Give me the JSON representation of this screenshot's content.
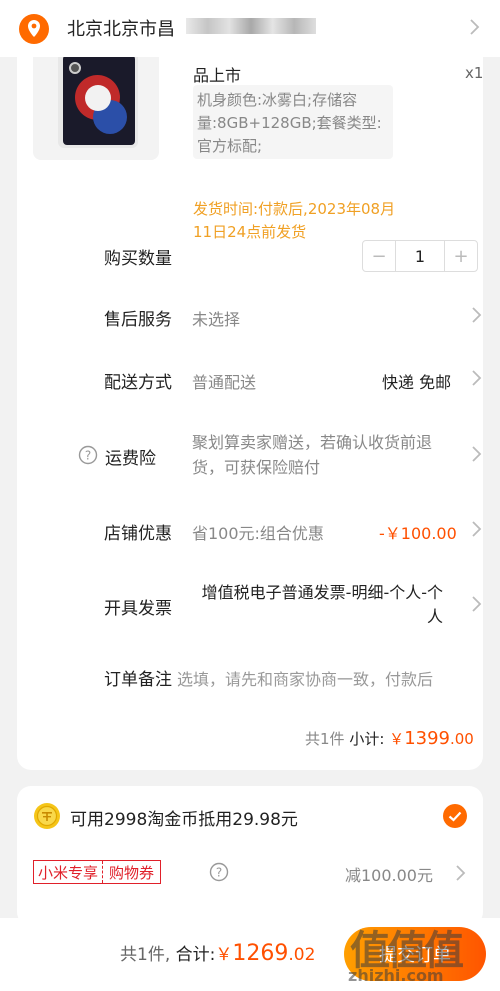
{
  "header": {
    "address": "北京北京市昌"
  },
  "product": {
    "name": "品上市",
    "quantity_mark": "x1",
    "specs": "机身颜色:冰雾白;存储容量:8GB+128GB;套餐类型:官方标配;",
    "ship_time": "发货时间:付款后,2023年08月11日24点前发货"
  },
  "rows": {
    "quantity": {
      "label": "购买数量",
      "value": "1",
      "minus": "−",
      "plus": "+"
    },
    "after_sales": {
      "label": "售后服务",
      "value": "未选择"
    },
    "delivery": {
      "label": "配送方式",
      "value": "普通配送",
      "option": "快递 免邮"
    },
    "insurance": {
      "label": "运费险",
      "value": "聚划算卖家赠送，若确认收货前退货，可获保险赔付"
    },
    "shop_discount": {
      "label": "店铺优惠",
      "value": "省100元:组合优惠",
      "amount": "-￥100.00"
    },
    "invoice": {
      "label": "开具发票",
      "value": "增值税电子普通发票-明细-个人-个人"
    },
    "note": {
      "label": "订单备注",
      "placeholder": "选填，请先和商家协商一致，付款后"
    }
  },
  "subtotal": {
    "count": "共1件",
    "label": "小计:",
    "currency": "￥",
    "integer": "1399",
    "decimal": ".00"
  },
  "coins": {
    "text": "可用2998淘金币抵用29.98元"
  },
  "coupon": {
    "tag_a": "小米专享",
    "tag_b": "购物券",
    "value": "减100.00元"
  },
  "footer": {
    "count": "共1件,",
    "label": "合计:",
    "currency": "￥",
    "integer": "1269",
    "decimal": ".02",
    "submit": "提交订单"
  },
  "watermark": {
    "big": "值值值",
    "small": "zhizhi.com"
  },
  "colors": {
    "accent": "#ff5000",
    "ship_time": "#f0a024",
    "tag": "#e0202a"
  }
}
